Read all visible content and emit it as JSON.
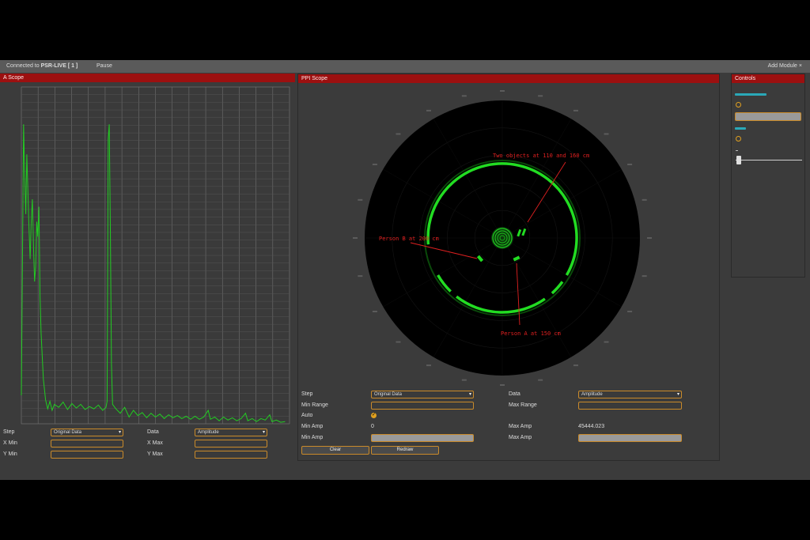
{
  "topbar": {
    "connection_prefix": "Connected to ",
    "connection_target": "PSR-LIVE [ 1 ]",
    "pause_label": "Pause",
    "add_module_label": "Add Module",
    "add_module_icon": "close-icon"
  },
  "ascope": {
    "title": "A Scope",
    "step_label": "Step",
    "step_value": "Original Data",
    "data_label": "Data",
    "data_value": "Amplitude",
    "xmin_label": "X Min",
    "xmax_label": "X Max",
    "ymin_label": "Y Min",
    "ymax_label": "Y Max",
    "xmin_value": "",
    "xmax_value": "",
    "ymin_value": "",
    "ymax_value": "",
    "line_color": "#22cc22",
    "signal": [
      [
        0,
        3800
      ],
      [
        2,
        40000
      ],
      [
        3,
        33000
      ],
      [
        4,
        28000
      ],
      [
        5,
        36000
      ],
      [
        6,
        31000
      ],
      [
        7,
        26000
      ],
      [
        8,
        22000
      ],
      [
        9,
        27000
      ],
      [
        10,
        30000
      ],
      [
        11,
        24000
      ],
      [
        12,
        19000
      ],
      [
        13,
        21000
      ],
      [
        14,
        27000
      ],
      [
        15,
        25000
      ],
      [
        16,
        29000
      ],
      [
        17,
        17000
      ],
      [
        18,
        12000
      ],
      [
        19,
        9000
      ],
      [
        20,
        6000
      ],
      [
        22,
        3200
      ],
      [
        24,
        2000
      ],
      [
        26,
        3000
      ],
      [
        28,
        1800
      ],
      [
        30,
        2600
      ],
      [
        34,
        2200
      ],
      [
        38,
        2900
      ],
      [
        42,
        1900
      ],
      [
        46,
        2700
      ],
      [
        50,
        2100
      ],
      [
        54,
        2600
      ],
      [
        58,
        1900
      ],
      [
        62,
        2300
      ],
      [
        66,
        2000
      ],
      [
        70,
        2500
      ],
      [
        74,
        1800
      ],
      [
        77,
        2200
      ],
      [
        78,
        3000
      ],
      [
        79,
        38000
      ],
      [
        80,
        40000
      ],
      [
        81,
        26000
      ],
      [
        82,
        8000
      ],
      [
        83,
        2600
      ],
      [
        86,
        2000
      ],
      [
        90,
        1400
      ],
      [
        94,
        2200
      ],
      [
        98,
        900
      ],
      [
        102,
        1800
      ],
      [
        106,
        1100
      ],
      [
        110,
        1500
      ],
      [
        114,
        800
      ],
      [
        118,
        1400
      ],
      [
        122,
        900
      ],
      [
        126,
        1300
      ],
      [
        130,
        700
      ],
      [
        134,
        1200
      ],
      [
        138,
        800
      ],
      [
        142,
        1100
      ],
      [
        146,
        700
      ],
      [
        150,
        1000
      ],
      [
        154,
        600
      ],
      [
        158,
        1000
      ],
      [
        162,
        600
      ],
      [
        166,
        900
      ],
      [
        170,
        1800
      ],
      [
        172,
        600
      ],
      [
        176,
        900
      ],
      [
        180,
        400
      ],
      [
        184,
        900
      ],
      [
        188,
        500
      ],
      [
        192,
        800
      ],
      [
        196,
        400
      ],
      [
        200,
        700
      ],
      [
        204,
        1400
      ],
      [
        206,
        400
      ],
      [
        210,
        700
      ],
      [
        214,
        300
      ],
      [
        218,
        700
      ],
      [
        222,
        500
      ],
      [
        226,
        1200
      ],
      [
        228,
        300
      ],
      [
        232,
        500
      ],
      [
        236,
        200
      ],
      [
        240,
        300
      ]
    ]
  },
  "ppi": {
    "title": "PPI Scope",
    "annotation_color": "#e02020",
    "ring_color": "#22dd22",
    "annotations": {
      "two_objects": "Two objects at 110 and 160 cm",
      "person_b": "Person B at 200 cm",
      "person_a": "Person A at 150 cm"
    },
    "step_label": "Step",
    "step_value": "Original Data",
    "data_label": "Data",
    "data_value": "Amplitude",
    "min_range_label": "Min Range",
    "max_range_label": "Max Range",
    "min_range_value": "",
    "max_range_value": "",
    "auto_label": "Auto",
    "min_amp_label": "Min Amp",
    "min_amp_value": "0",
    "max_amp_label": "Max Amp",
    "max_amp_value": "45444.023",
    "clear_label": "Clear",
    "redraw_label": "Redraw"
  },
  "controls": {
    "title": "Controls",
    "accent_color": "#2aa8b8",
    "slider_level": 0.05
  }
}
